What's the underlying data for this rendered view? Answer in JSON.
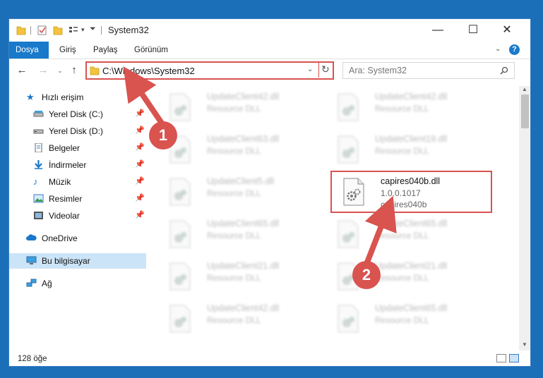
{
  "window": {
    "title": "System32",
    "controls": {
      "minimize": "—",
      "maximize": "☐",
      "close": "✕"
    }
  },
  "ribbon": {
    "tabs": [
      {
        "label": "Dosya"
      },
      {
        "label": "Giriş"
      },
      {
        "label": "Paylaş"
      },
      {
        "label": "Görünüm"
      }
    ]
  },
  "address": {
    "path": "C:\\Windows\\System32"
  },
  "search": {
    "placeholder": "Ara: System32"
  },
  "sidebar": {
    "quick_access": "Hızlı erişim",
    "items": [
      {
        "label": "Yerel Disk (C:)",
        "icon": "drive-icon",
        "pinned": true
      },
      {
        "label": "Yerel Disk (D:)",
        "icon": "drive-icon",
        "pinned": true
      },
      {
        "label": "Belgeler",
        "icon": "documents-icon",
        "pinned": true
      },
      {
        "label": "İndirmeler",
        "icon": "downloads-icon",
        "pinned": true
      },
      {
        "label": "Müzik",
        "icon": "music-icon",
        "pinned": true
      },
      {
        "label": "Resimler",
        "icon": "pictures-icon",
        "pinned": true
      },
      {
        "label": "Videolar",
        "icon": "videos-icon",
        "pinned": true
      }
    ],
    "onedrive": "OneDrive",
    "this_pc": "Bu bilgisayar",
    "network": "Ağ"
  },
  "files": [
    {
      "name": "UpdateClient42.dll",
      "desc": "Resource DLL"
    },
    {
      "name": "UpdateClient42.dll",
      "desc": "Resource DLL"
    },
    {
      "name": "UpdateClient63.dll",
      "desc": "Resource DLL"
    },
    {
      "name": "UpdateClient19.dll",
      "desc": "Resource DLL"
    },
    {
      "name": "UpdateClient5.dll",
      "desc": "Resource DLL"
    },
    {
      "name": "capires040b.dll",
      "version": "1.0.0.1017",
      "desc": "capires040b"
    },
    {
      "name": "UpdateClient65.dll",
      "desc": "Resource DLL"
    },
    {
      "name": "UpdateClient65.dll",
      "desc": "Resource DLL"
    },
    {
      "name": "UpdateClient21.dll",
      "desc": "Resource DLL"
    },
    {
      "name": "UpdateClient21.dll",
      "desc": "Resource DLL"
    },
    {
      "name": "UpdateClient42.dll",
      "desc": "Resource DLL"
    },
    {
      "name": "UpdateClient65.dll",
      "desc": "Resource DLL"
    }
  ],
  "status": {
    "count": "128 öğe"
  },
  "annotations": {
    "badge1": "1",
    "badge2": "2",
    "color": "#d9534f"
  }
}
